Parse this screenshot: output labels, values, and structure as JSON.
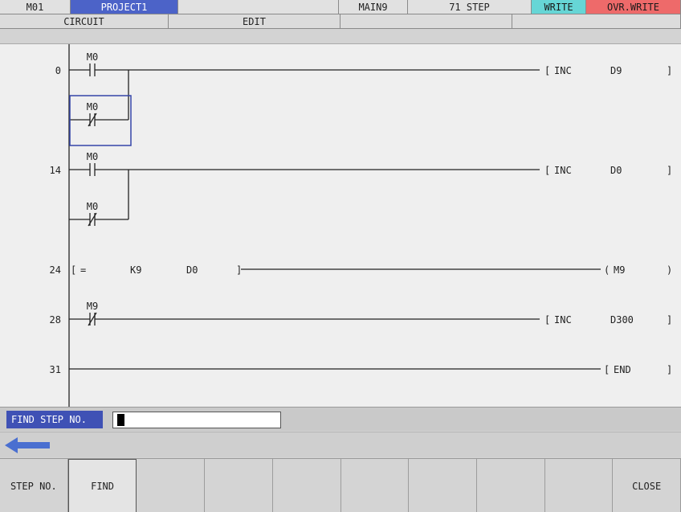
{
  "status_bar": {
    "machine": "M01",
    "project": "PROJECT1",
    "blank": "",
    "program": "MAIN9",
    "steps": "71 STEP",
    "write": "WRITE",
    "ovr_write": "OVR.WRITE"
  },
  "mode_bar": {
    "circuit": "CIRCUIT",
    "edit": "EDIT"
  },
  "ladder": {
    "rungs": [
      {
        "step": "0",
        "contacts": [
          {
            "device": "M0",
            "type": "NO"
          },
          {
            "device": "M0",
            "type": "NC",
            "selected": true
          }
        ],
        "instruction": "INC",
        "operand": "D9"
      },
      {
        "step": "14",
        "contacts": [
          {
            "device": "M0",
            "type": "NO"
          },
          {
            "device": "M0",
            "type": "NC"
          }
        ],
        "instruction": "INC",
        "operand": "D0"
      },
      {
        "step": "24",
        "compare": {
          "op": "=",
          "a": "K9",
          "b": "D0"
        },
        "coil": "M9"
      },
      {
        "step": "28",
        "contacts": [
          {
            "device": "M9",
            "type": "NC"
          }
        ],
        "instruction": "INC",
        "operand": "D300"
      },
      {
        "step": "31",
        "instruction": "END"
      }
    ]
  },
  "find": {
    "label": "FIND STEP NO.",
    "value": ""
  },
  "softkeys": [
    "STEP NO.",
    "FIND",
    "",
    "",
    "",
    "",
    "",
    "",
    "",
    "CLOSE"
  ],
  "colors": {
    "project_bg": "#4c63c8",
    "write_bg": "#66d6d6",
    "ovr_write_bg": "#ee6a6a",
    "find_label_bg": "#3f51b5",
    "selection": "#3545a8"
  },
  "icons": {
    "back": "left-arrow-icon"
  }
}
